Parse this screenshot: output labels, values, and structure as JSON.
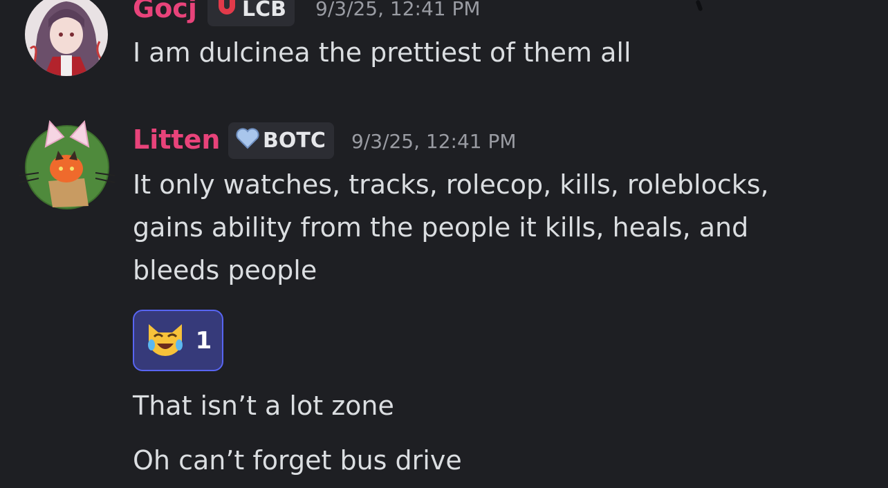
{
  "messages": [
    {
      "author": "Gocj",
      "tag": "LCB",
      "timestamp": "9/3/25, 12:41 PM",
      "lines": [
        "I am dulcinea the prettiest of them all"
      ]
    },
    {
      "author": "Litten",
      "tag": "BOTC",
      "timestamp": "9/3/25, 12:41 PM",
      "lines": [
        "It only watches, tracks, rolecop, kills, roleblocks,",
        "gains ability from the people it kills, heals, and",
        "bleeds people"
      ],
      "reaction": {
        "emoji": "😹",
        "count": "1"
      },
      "followups": [
        "That isn’t a lot zone",
        "Oh can’t forget bus drive"
      ]
    }
  ],
  "icons": {
    "gocj_tag_icon": "red-horseshoe-magnet-icon",
    "litten_tag_icon": "light-blue-heart-icon",
    "reaction_icon": "cat-with-tears-of-joy-icon"
  },
  "colors": {
    "background": "#1e1f23",
    "author_name": "#e8437a",
    "message_text": "#dbdee1",
    "timestamp": "#9a9ca3",
    "tag_bg": "#2c2d33",
    "reaction_bg": "#363a7a",
    "reaction_border": "#5865f2"
  }
}
